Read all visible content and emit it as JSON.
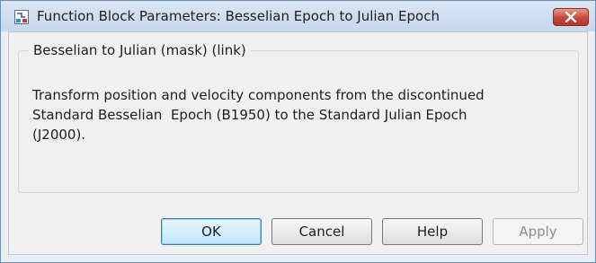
{
  "window": {
    "title": "Function Block Parameters: Besselian Epoch to Julian Epoch",
    "icon": "simulink-block-icon",
    "close_icon": "close-icon"
  },
  "group": {
    "legend": "Besselian to Julian (mask) (link)",
    "description_lines": [
      "Transform position and velocity components from the discontinued",
      "Standard Besselian  Epoch (B1950) to the Standard Julian Epoch",
      "(J2000)."
    ]
  },
  "buttons": {
    "ok": "OK",
    "cancel": "Cancel",
    "help": "Help",
    "apply": "Apply"
  },
  "colors": {
    "close_button": "#c7473a",
    "default_button_border": "#3c7fb1",
    "titlebar": "#c5d7ec"
  }
}
